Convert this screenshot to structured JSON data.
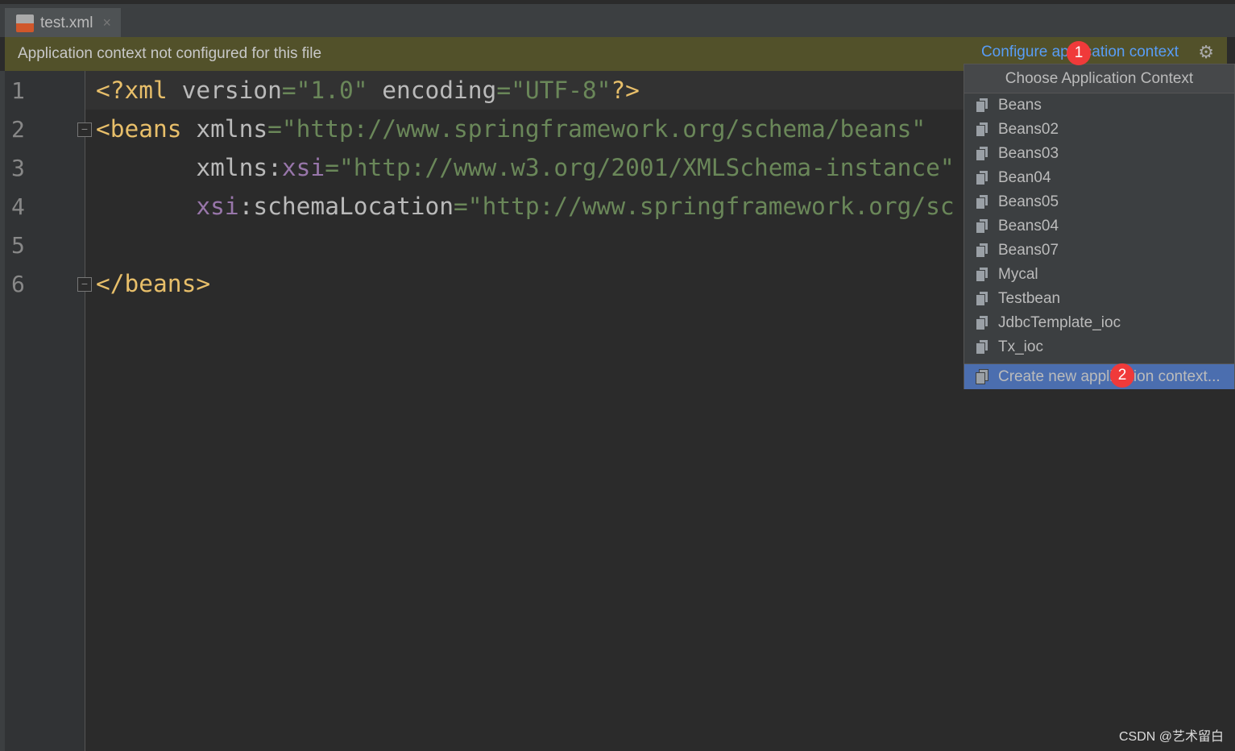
{
  "tab": {
    "filename": "test.xml",
    "icon": "xml-spring-file-icon",
    "close": "×"
  },
  "banner": {
    "message": "Application context not configured for this file",
    "link": "Configure application context",
    "gear_icon": "gear-icon"
  },
  "badges": [
    "1",
    "2"
  ],
  "editor": {
    "line_numbers": [
      "1",
      "2",
      "3",
      "4",
      "5",
      "6"
    ]
  },
  "popup": {
    "title": "Choose Application Context",
    "items": [
      "Beans",
      "Beans02",
      "Beans03",
      "Bean04",
      "Beans05",
      "Beans04",
      "Beans07",
      "Mycal",
      "Testbean",
      "JdbcTemplate_ioc",
      "Tx_ioc"
    ],
    "create": "Create new application context..."
  },
  "watermark": "CSDN @艺术留白",
  "colors": {
    "tag": "#e8bf6a",
    "value": "#6a8759",
    "prefix": "#9876aa",
    "link": "#589df6",
    "selection": "#4b6eaf",
    "banner": "#52512a"
  }
}
